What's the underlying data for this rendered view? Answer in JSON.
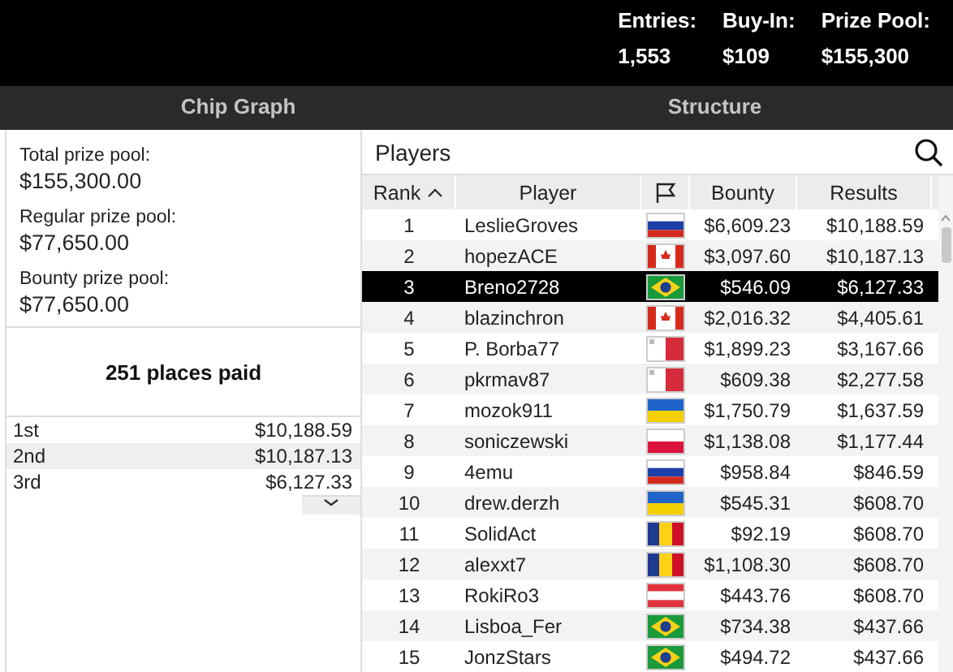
{
  "header": {
    "stats": [
      {
        "label": "Entries:",
        "value": "1,553"
      },
      {
        "label": "Buy-In:",
        "value": "$109"
      },
      {
        "label": "Prize Pool:",
        "value": "$155,300"
      }
    ]
  },
  "tabs": [
    {
      "label": "Chip Graph",
      "selected": false
    },
    {
      "label": "Structure",
      "selected": false
    }
  ],
  "prize_pools": [
    {
      "label": "Total prize pool:",
      "value": "$155,300.00"
    },
    {
      "label": "Regular prize pool:",
      "value": "$77,650.00"
    },
    {
      "label": "Bounty prize pool:",
      "value": "$77,650.00"
    }
  ],
  "places_paid": "251 places paid",
  "payouts": [
    {
      "place": "1st",
      "amount": "$10,188.59"
    },
    {
      "place": "2nd",
      "amount": "$10,187.13"
    },
    {
      "place": "3rd",
      "amount": "$6,127.33"
    }
  ],
  "players": {
    "title": "Players",
    "columns": [
      {
        "label": "Rank",
        "sorted": true
      },
      {
        "label": "Player",
        "sorted": false
      },
      {
        "kind": "flag",
        "sorted": false
      },
      {
        "label": "Bounty",
        "sorted": false
      },
      {
        "label": "Results",
        "sorted": false
      }
    ],
    "rows": [
      {
        "rank": "1",
        "player": "LeslieGroves",
        "flag": {
          "kind": "ru"
        },
        "bounty": "$6,609.23",
        "results": "$10,188.59",
        "selected": false
      },
      {
        "rank": "2",
        "player": "hopezACE",
        "flag": {
          "kind": "ca"
        },
        "bounty": "$3,097.60",
        "results": "$10,187.13",
        "selected": false
      },
      {
        "rank": "3",
        "player": "Breno2728",
        "flag": {
          "kind": "br"
        },
        "bounty": "$546.09",
        "results": "$6,127.33",
        "selected": true
      },
      {
        "rank": "4",
        "player": "blazinchron",
        "flag": {
          "kind": "ca"
        },
        "bounty": "$2,016.32",
        "results": "$4,405.61",
        "selected": false
      },
      {
        "rank": "5",
        "player": "P. Borba77",
        "flag": {
          "kind": "mt"
        },
        "bounty": "$1,899.23",
        "results": "$3,167.66",
        "selected": false
      },
      {
        "rank": "6",
        "player": "pkrmav87",
        "flag": {
          "kind": "mt"
        },
        "bounty": "$609.38",
        "results": "$2,277.58",
        "selected": false
      },
      {
        "rank": "7",
        "player": "mozok911",
        "flag": {
          "kind": "ua"
        },
        "bounty": "$1,750.79",
        "results": "$1,637.59",
        "selected": false
      },
      {
        "rank": "8",
        "player": "soniczewski",
        "flag": {
          "kind": "pl"
        },
        "bounty": "$1,138.08",
        "results": "$1,177.44",
        "selected": false
      },
      {
        "rank": "9",
        "player": "4emu",
        "flag": {
          "kind": "ru"
        },
        "bounty": "$958.84",
        "results": "$846.59",
        "selected": false
      },
      {
        "rank": "10",
        "player": "drew.derzh",
        "flag": {
          "kind": "ua"
        },
        "bounty": "$545.31",
        "results": "$608.70",
        "selected": false
      },
      {
        "rank": "11",
        "player": "SolidAct",
        "flag": {
          "kind": "ro"
        },
        "bounty": "$92.19",
        "results": "$608.70",
        "selected": false
      },
      {
        "rank": "12",
        "player": "alexxt7",
        "flag": {
          "kind": "ro"
        },
        "bounty": "$1,108.30",
        "results": "$608.70",
        "selected": false
      },
      {
        "rank": "13",
        "player": "RokiRo3",
        "flag": {
          "kind": "at"
        },
        "bounty": "$443.76",
        "results": "$608.70",
        "selected": false
      },
      {
        "rank": "14",
        "player": "Lisboa_Fer",
        "flag": {
          "kind": "br"
        },
        "bounty": "$734.38",
        "results": "$437.66",
        "selected": false
      },
      {
        "rank": "15",
        "player": "JonzStars",
        "flag": {
          "kind": "br"
        },
        "bounty": "$494.72",
        "results": "$437.66",
        "selected": false
      }
    ]
  }
}
